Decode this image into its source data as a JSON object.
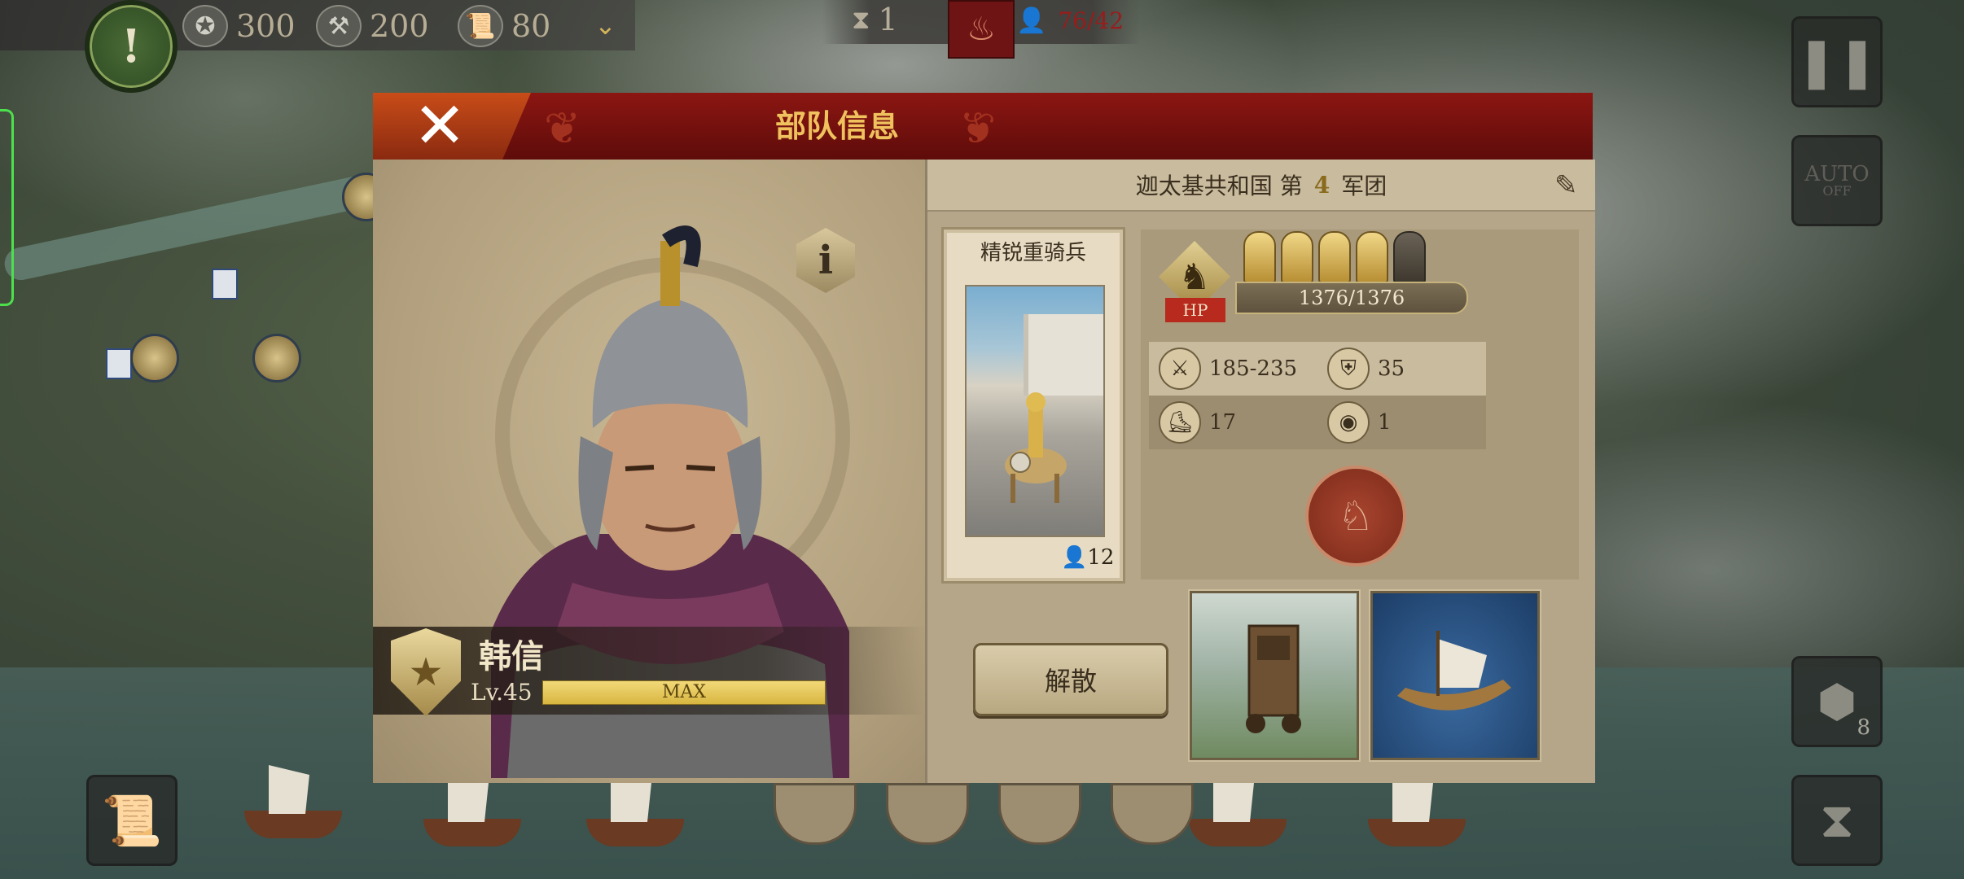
{
  "hud": {
    "resources": [
      {
        "icon": "eagle-shield-icon",
        "value": "300"
      },
      {
        "icon": "hammer-icon",
        "value": "200"
      },
      {
        "icon": "scroll-icon",
        "value": "80"
      }
    ],
    "turn_value": "1",
    "population": "76/42",
    "population_color": "#9b1b1b"
  },
  "dialog": {
    "title": "部队信息",
    "legion": {
      "prefix": "迦太基共和国 第",
      "number": "4",
      "suffix": "军团"
    },
    "hero": {
      "name": "韩信",
      "level": "Lv.45",
      "exp_label": "MAX",
      "exp_fraction": 1.0
    },
    "unit": {
      "name": "精锐重骑兵",
      "count": "12",
      "hp_label": "HP",
      "hp": "1376/1376",
      "rank_active": 4,
      "rank_total": 5,
      "stats": {
        "attack": "185-235",
        "defense": "35",
        "movement": "17",
        "vision": "1"
      }
    },
    "disband_label": "解散"
  },
  "side_buttons": {
    "auto_label": "AUTO",
    "auto_state": "OFF",
    "hex_count": "8"
  },
  "colors": {
    "title_bar": "#7a110e",
    "title_text": "#f0c25e",
    "close_button": "#b8421a"
  }
}
